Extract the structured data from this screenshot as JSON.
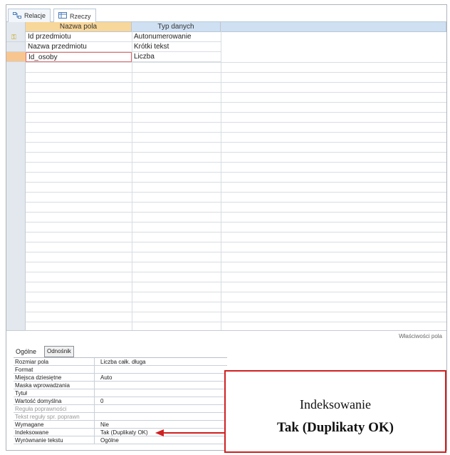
{
  "tabs": [
    {
      "label": "Relacje",
      "icon": "relationships-icon"
    },
    {
      "label": "Rzeczy",
      "icon": "table-icon"
    }
  ],
  "grid": {
    "headers": [
      "Nazwa pola",
      "Typ danych"
    ],
    "rows": [
      {
        "field": "Id przedmiotu",
        "type": "Autonumerowanie",
        "key": true
      },
      {
        "field": "Nazwa przedmiotu",
        "type": "Krótki tekst",
        "key": false
      },
      {
        "field": "Id_osoby",
        "type": "Liczba",
        "key": false
      }
    ]
  },
  "properties": {
    "panel_label": "Właściwości pola",
    "tabs": [
      "Ogólne",
      "Odnośnik"
    ],
    "rows": [
      {
        "label": "Rozmiar pola",
        "value": "Liczba całk. długa"
      },
      {
        "label": "Format",
        "value": ""
      },
      {
        "label": "Miejsca dziesiętne",
        "value": "Auto"
      },
      {
        "label": "Maska wprowadzania",
        "value": ""
      },
      {
        "label": "Tytuł",
        "value": ""
      },
      {
        "label": "Wartość domyślna",
        "value": "0"
      },
      {
        "label": "Reguła poprawności",
        "value": ""
      },
      {
        "label": "Tekst reguły spr. poprawn",
        "value": ""
      },
      {
        "label": "Wymagane",
        "value": "Nie"
      },
      {
        "label": "Indeksowane",
        "value": "Tak (Duplikaty OK)"
      },
      {
        "label": "Wyrównanie tekstu",
        "value": "Ogólne"
      }
    ]
  },
  "callout": {
    "line1": "Indeksowanie",
    "line2": "Tak (Duplikaty OK)",
    "color": "#d02020"
  }
}
